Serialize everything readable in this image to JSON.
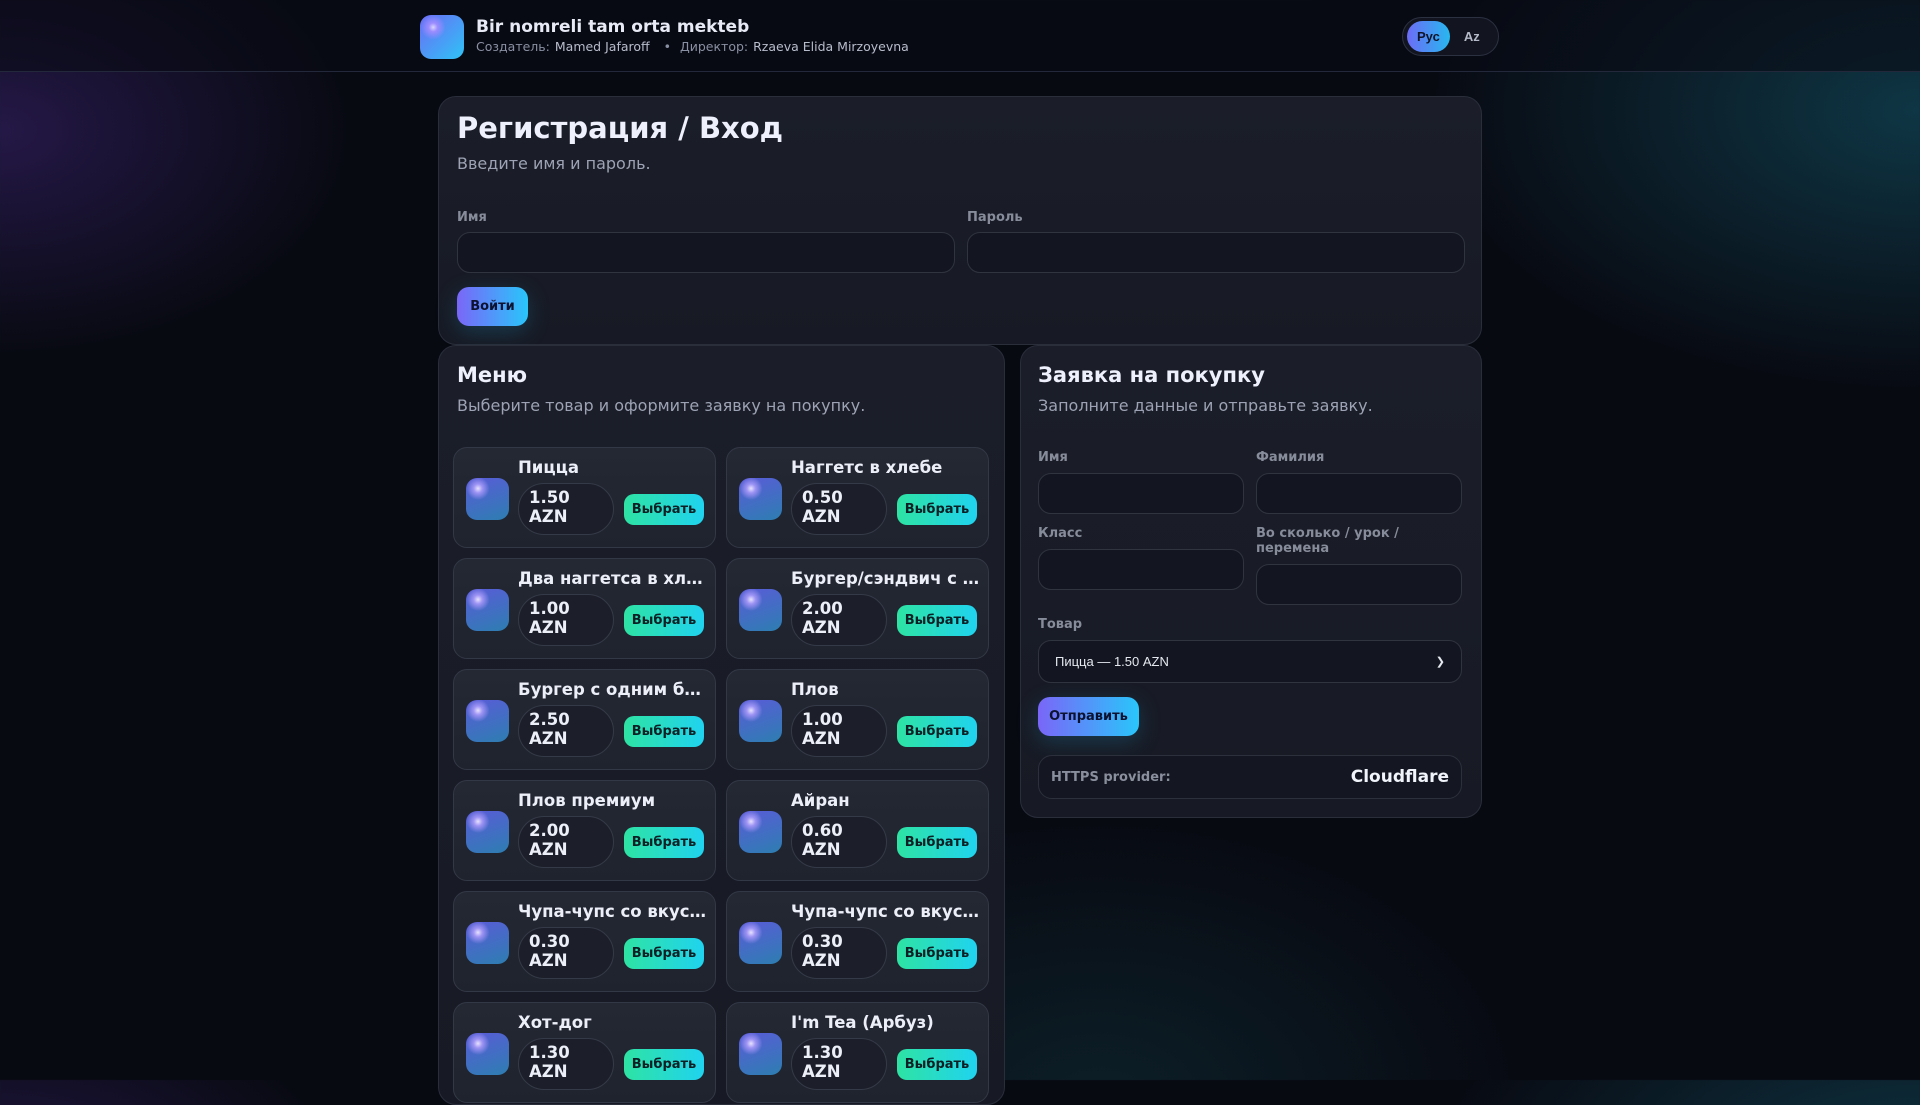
{
  "header": {
    "title": "Bir nomreli tam orta mekteb",
    "creator_label": "Создатель:",
    "creator": "Mamed Jafaroff",
    "separator": "•",
    "director_label": "Директор:",
    "director": "Rzaeva Elida Mirzoyevna",
    "lang": [
      "Рус",
      "Az"
    ]
  },
  "login": {
    "title": "Регистрация / Вход",
    "subtitle": "Введите имя и пароль.",
    "name_label": "Имя",
    "password_label": "Пароль",
    "submit": "Войти"
  },
  "menu": {
    "title": "Меню",
    "subtitle": "Выберите товар и оформите заявку на покупку.",
    "select_label": "Выбрать",
    "items": [
      {
        "name": "Пицца",
        "price": "1.50",
        "currency": "AZN"
      },
      {
        "name": "Наггетс в хлебе",
        "price": "0.50",
        "currency": "AZN"
      },
      {
        "name": "Два наггетса в хл…",
        "price": "1.00",
        "currency": "AZN"
      },
      {
        "name": "Бургер/сэндвич с …",
        "price": "2.00",
        "currency": "AZN"
      },
      {
        "name": "Бургер с одним б…",
        "price": "2.50",
        "currency": "AZN"
      },
      {
        "name": "Плов",
        "price": "1.00",
        "currency": "AZN"
      },
      {
        "name": "Плов премиум",
        "price": "2.00",
        "currency": "AZN"
      },
      {
        "name": "Айран",
        "price": "0.60",
        "currency": "AZN"
      },
      {
        "name": "Чупа-чупс со вкус…",
        "price": "0.30",
        "currency": "AZN"
      },
      {
        "name": "Чупа-чупс со вкус…",
        "price": "0.30",
        "currency": "AZN"
      },
      {
        "name": "Хот-дог",
        "price": "1.30",
        "currency": "AZN"
      },
      {
        "name": "I'm Tea (Арбуз)",
        "price": "1.30",
        "currency": "AZN"
      }
    ]
  },
  "order": {
    "title": "Заявка на покупку",
    "subtitle": "Заполните данные и отправьте заявку.",
    "first_name_label": "Имя",
    "last_name_label": "Фамилия",
    "class_label": "Класс",
    "time_label": "Во сколько / урок / перемена",
    "product_label": "Товар",
    "product_value": "Пицца — 1.50 AZN",
    "submit": "Отправить",
    "https_label": "HTTPS provider:",
    "https_value": "Cloudflare"
  }
}
